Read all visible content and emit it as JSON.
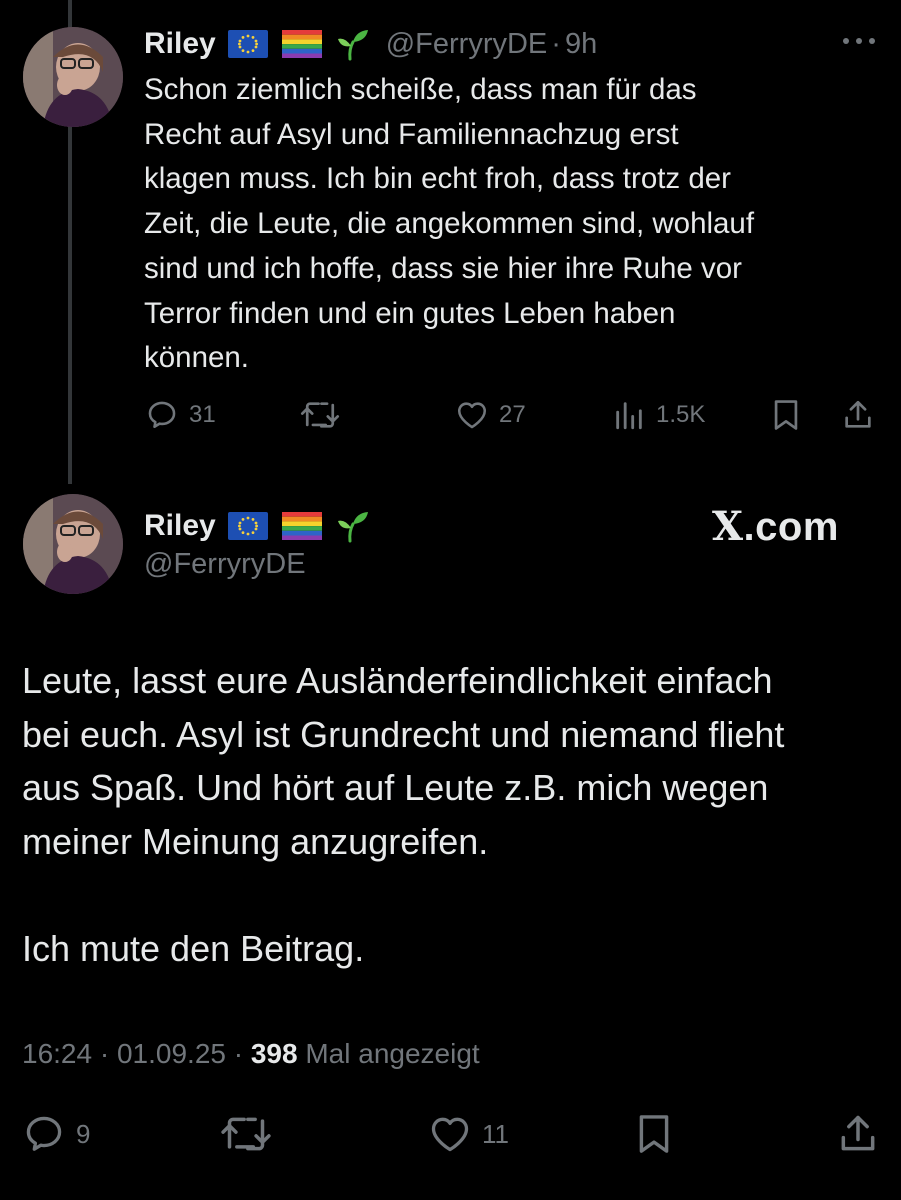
{
  "tweet1": {
    "author_name": "Riley",
    "handle": "@FerryryDE",
    "separator": "·",
    "time_ago": "9h",
    "text_lines": [
      "Schon ziemlich scheiße, dass man für das",
      "Recht auf Asyl und Familiennachzug erst",
      "klagen muss. Ich bin echt froh, dass trotz der",
      "Zeit, die Leute, die angekommen sind, wohlauf",
      "sind und ich hoffe, dass sie hier ihre Ruhe vor",
      "Terror finden und ein gutes Leben haben",
      "können."
    ],
    "replies": "31",
    "likes": "27",
    "views": "1.5K",
    "icons": [
      "more-icon",
      "reply-icon",
      "repost-icon",
      "like-icon",
      "views-icon",
      "bookmark-icon",
      "share-icon"
    ]
  },
  "tweet2": {
    "author_name": "Riley",
    "handle": "@FerryryDE",
    "watermark": "X.com",
    "watermark_x": "X",
    "watermark_rest": ".com",
    "text_lines": [
      "Leute, lasst eure Ausländerfeindlichkeit einfach",
      "bei euch. Asyl ist Grundrecht und niemand flieht",
      "aus Spaß. Und hört auf Leute z.B. mich wegen",
      "meiner Meinung anzugreifen.",
      "",
      "Ich mute den Beitrag."
    ],
    "time": "16:24",
    "date": "01.09.25",
    "view_count": "398",
    "view_label": "Mal angezeigt",
    "separator": "·",
    "replies": "9",
    "likes": "11"
  },
  "badges": [
    "eu-flag-icon",
    "rainbow-flag-icon",
    "seedling-icon"
  ],
  "colors": {
    "background": "#000000",
    "text_primary": "#e7e9ea",
    "text_secondary": "#71767b",
    "thread_line": "#333639"
  }
}
